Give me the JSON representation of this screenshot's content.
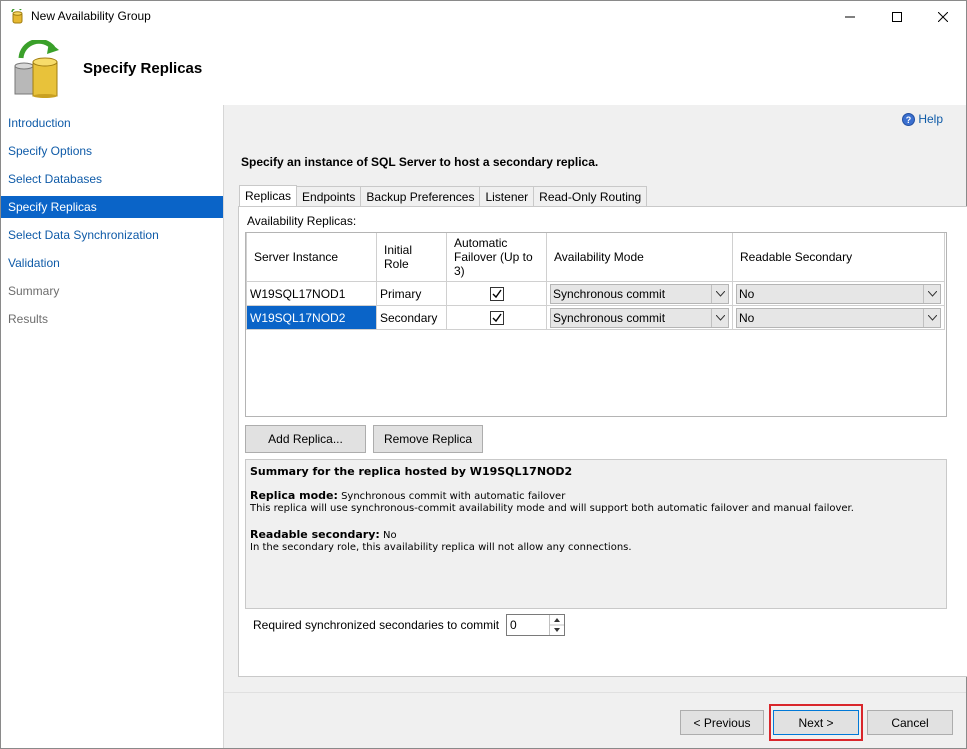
{
  "window": {
    "title": "New Availability Group"
  },
  "banner": {
    "title": "Specify Replicas"
  },
  "sidebar": {
    "items": [
      {
        "label": "Introduction",
        "state": "link"
      },
      {
        "label": "Specify Options",
        "state": "link"
      },
      {
        "label": "Select Databases",
        "state": "link"
      },
      {
        "label": "Specify Replicas",
        "state": "active"
      },
      {
        "label": "Select Data Synchronization",
        "state": "link"
      },
      {
        "label": "Validation",
        "state": "link"
      },
      {
        "label": "Summary",
        "state": "disabled"
      },
      {
        "label": "Results",
        "state": "disabled"
      }
    ]
  },
  "help": {
    "label": "Help"
  },
  "main": {
    "instruction": "Specify an instance of SQL Server to host a secondary replica.",
    "tabs": [
      {
        "label": "Replicas",
        "active": true
      },
      {
        "label": "Endpoints"
      },
      {
        "label": "Backup Preferences"
      },
      {
        "label": "Listener"
      },
      {
        "label": "Read-Only Routing"
      }
    ],
    "group_label": "Availability Replicas:",
    "grid": {
      "headers": [
        "Server Instance",
        "Initial Role",
        "Automatic Failover (Up to 3)",
        "Availability Mode",
        "Readable Secondary"
      ],
      "rows": [
        {
          "server": "W19SQL17NOD1",
          "role": "Primary",
          "auto_failover": true,
          "mode": "Synchronous commit",
          "readable": "No",
          "selected": false
        },
        {
          "server": "W19SQL17NOD2",
          "role": "Secondary",
          "auto_failover": true,
          "mode": "Synchronous commit",
          "readable": "No",
          "selected": true
        }
      ]
    },
    "add_replica_label": "Add Replica...",
    "remove_replica_label": "Remove Replica",
    "summary": {
      "heading": "Summary for the replica hosted by W19SQL17NOD2",
      "replica_mode_label": "Replica mode:",
      "replica_mode_value": "Synchronous commit with automatic failover",
      "replica_mode_desc": "This replica will use synchronous-commit availability mode and will support both automatic failover and manual failover.",
      "readable_label": "Readable secondary:",
      "readable_value": "No",
      "readable_desc": "In the secondary role, this availability replica will not allow any connections."
    },
    "required_label": "Required synchronized secondaries to commit",
    "required_value": "0"
  },
  "footer": {
    "previous_label": "< Previous",
    "next_label": "Next >",
    "cancel_label": "Cancel"
  },
  "colors": {
    "accent": "#0a64c8",
    "highlight": "#d9262b"
  }
}
